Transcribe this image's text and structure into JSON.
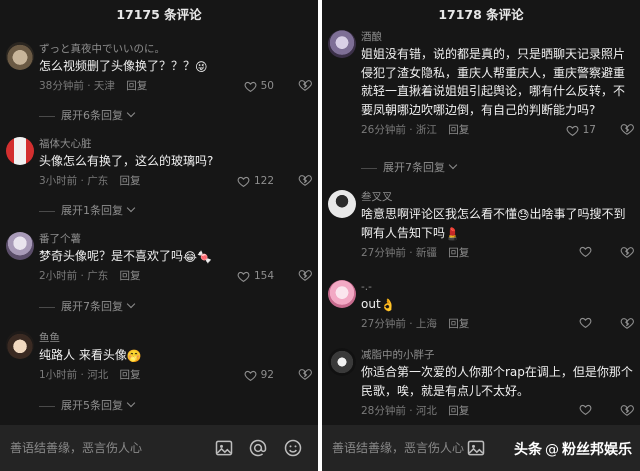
{
  "left": {
    "header": "17175 条评论",
    "comments": [
      {
        "user": "ずっと真夜中でいいのに。",
        "text": "怎么视频删了头像换了？？？",
        "emoji": "😜",
        "time": "38分钟前 · 天津",
        "reply": "回复",
        "likes": "50",
        "expand": "展开6条回复"
      },
      {
        "user": "福体大心脏",
        "text": "头像怎么有换了，这么的玻璃吗?",
        "emoji": "",
        "time": "3小时前 · 广东",
        "reply": "回复",
        "likes": "122",
        "expand": "展开1条回复"
      },
      {
        "user": "番了个薯",
        "text": "梦奇头像呢？是不喜欢了吗",
        "emoji": "😂🍬",
        "time": "2小时前 · 广东",
        "reply": "回复",
        "likes": "154",
        "expand": "展开7条回复"
      },
      {
        "user": "鱼鱼",
        "text": "纯路人 来看头像",
        "emoji": "🤭",
        "time": "1小时前 · 河北",
        "reply": "回复",
        "likes": "92",
        "expand": "展开5条回复"
      }
    ],
    "input_placeholder": "善语结善缘，恶言伤人心"
  },
  "right": {
    "header": "17178 条评论",
    "comments": [
      {
        "user": "酒酿",
        "text": "姐姐没有错，说的都是真的，只是晒聊天记录照片侵犯了渣女隐私，重庆人帮重庆人，重庆警察避重就轻一直揪着说姐姐引起舆论，哪有什么反转，不要凤朝哪边吹哪边倒，有自己的判断能力吗?",
        "emoji": "",
        "time": "26分钟前 · 浙江",
        "reply": "回复",
        "likes": "17",
        "expand": "展开7条回复"
      },
      {
        "user": "叁叉叉",
        "text": "啥意思啊评论区我怎么看不懂",
        "emoji": "😓",
        "text2": "出啥事了吗搜不到啊有人告知下吗",
        "emoji2": "💄",
        "time": "27分钟前 · 新疆",
        "reply": "回复",
        "likes": ""
      },
      {
        "user": "-.-",
        "text": "out",
        "emoji": "👌",
        "time": "27分钟前 · 上海",
        "reply": "回复",
        "likes": ""
      },
      {
        "user": "减脂中的小胖子",
        "text": "你适合第一次爱的人你那个rap在调上，但是你那个民歌，唉，就是有点儿不太好。",
        "emoji": "",
        "time": "28分钟前 · 河北",
        "reply": "回复",
        "likes": ""
      }
    ],
    "input_placeholder": "善语结善缘，恶言伤人心"
  },
  "brand": {
    "part1": "头条",
    "sep": "@",
    "part2": "粉丝邦娱乐"
  },
  "colors": {
    "background": "#161616",
    "input_bar": "#242424",
    "text": "#f0f0f0",
    "muted": "#8e8e8e"
  }
}
